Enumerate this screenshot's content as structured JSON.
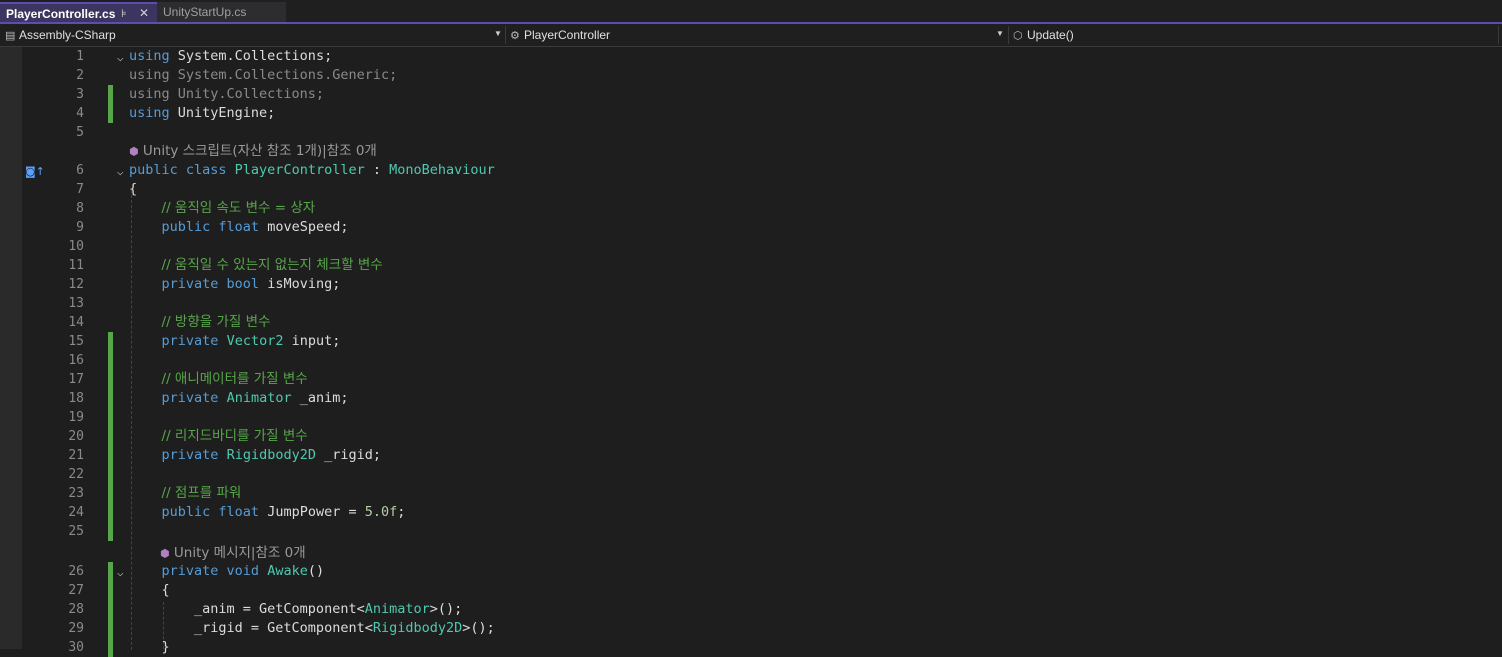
{
  "tabs": [
    {
      "label": "PlayerController.cs",
      "active": true
    },
    {
      "label": "UnityStartUp.cs",
      "active": false
    }
  ],
  "nav": {
    "project": "Assembly-CSharp",
    "class": "PlayerController",
    "member": "Update()"
  },
  "codelens": {
    "class_lens": "Unity 스크립트(자산 참조 1개)|참조 0개",
    "method_lens": "Unity 메시지|참조 0개"
  },
  "lines": [
    {
      "n": "1",
      "tokens": [
        [
          "kw",
          "using"
        ],
        [
          "tx",
          " System.Collections;"
        ]
      ]
    },
    {
      "n": "2",
      "tokens": [
        [
          "dim",
          "using System.Collections.Generic;"
        ]
      ]
    },
    {
      "n": "3",
      "tokens": [
        [
          "dim",
          "using Unity.Collections;"
        ]
      ]
    },
    {
      "n": "4",
      "tokens": [
        [
          "kw",
          "using"
        ],
        [
          "tx",
          " UnityEngine;"
        ]
      ]
    },
    {
      "n": "5",
      "tokens": []
    },
    {
      "n": "6",
      "tokens": [
        [
          "kw",
          "public class "
        ],
        [
          "ty",
          "PlayerController"
        ],
        [
          "tx",
          " : "
        ],
        [
          "ty",
          "MonoBehaviour"
        ]
      ]
    },
    {
      "n": "7",
      "tokens": [
        [
          "tx",
          "{"
        ]
      ]
    },
    {
      "n": "8",
      "tokens": [
        [
          "tx",
          "    "
        ],
        [
          "cm",
          "// 움직임 속도 변수 = 상자"
        ]
      ]
    },
    {
      "n": "9",
      "tokens": [
        [
          "tx",
          "    "
        ],
        [
          "kw",
          "public float"
        ],
        [
          "tx",
          " moveSpeed;"
        ]
      ]
    },
    {
      "n": "10",
      "tokens": []
    },
    {
      "n": "11",
      "tokens": [
        [
          "tx",
          "    "
        ],
        [
          "cm",
          "// 움직일 수 있는지 없는지 체크할 변수"
        ]
      ]
    },
    {
      "n": "12",
      "tokens": [
        [
          "tx",
          "    "
        ],
        [
          "kw",
          "private bool"
        ],
        [
          "tx",
          " isMoving;"
        ]
      ]
    },
    {
      "n": "13",
      "tokens": []
    },
    {
      "n": "14",
      "tokens": [
        [
          "tx",
          "    "
        ],
        [
          "cm",
          "// 방향을 가질 변수"
        ]
      ]
    },
    {
      "n": "15",
      "tokens": [
        [
          "tx",
          "    "
        ],
        [
          "kw",
          "private"
        ],
        [
          "tx",
          " "
        ],
        [
          "ty",
          "Vector2"
        ],
        [
          "tx",
          " input;"
        ]
      ]
    },
    {
      "n": "16",
      "tokens": []
    },
    {
      "n": "17",
      "tokens": [
        [
          "tx",
          "    "
        ],
        [
          "cm",
          "// 애니메이터를 가질 변수"
        ]
      ]
    },
    {
      "n": "18",
      "tokens": [
        [
          "tx",
          "    "
        ],
        [
          "kw",
          "private"
        ],
        [
          "tx",
          " "
        ],
        [
          "ty",
          "Animator"
        ],
        [
          "tx",
          " _anim;"
        ]
      ]
    },
    {
      "n": "19",
      "tokens": []
    },
    {
      "n": "20",
      "tokens": [
        [
          "tx",
          "    "
        ],
        [
          "cm",
          "// 리지드바디를 가질 변수"
        ]
      ]
    },
    {
      "n": "21",
      "tokens": [
        [
          "tx",
          "    "
        ],
        [
          "kw",
          "private"
        ],
        [
          "tx",
          " "
        ],
        [
          "ty",
          "Rigidbody2D"
        ],
        [
          "tx",
          " _rigid;"
        ]
      ]
    },
    {
      "n": "22",
      "tokens": []
    },
    {
      "n": "23",
      "tokens": [
        [
          "tx",
          "    "
        ],
        [
          "cm",
          "// 점프를 파워"
        ]
      ]
    },
    {
      "n": "24",
      "tokens": [
        [
          "tx",
          "    "
        ],
        [
          "kw",
          "public float"
        ],
        [
          "tx",
          " JumpPower = "
        ],
        [
          "nm",
          "5.0f"
        ],
        [
          "tx",
          ";"
        ]
      ]
    },
    {
      "n": "25",
      "tokens": []
    },
    {
      "n": "26",
      "tokens": [
        [
          "tx",
          "    "
        ],
        [
          "kw",
          "private void"
        ],
        [
          "tx",
          " "
        ],
        [
          "ty",
          "Awake"
        ],
        [
          "tx",
          "()"
        ]
      ]
    },
    {
      "n": "27",
      "tokens": [
        [
          "tx",
          "    {"
        ]
      ]
    },
    {
      "n": "28",
      "tokens": [
        [
          "tx",
          "        _anim = GetComponent<"
        ],
        [
          "ty",
          "Animator"
        ],
        [
          "tx",
          ">();"
        ]
      ]
    },
    {
      "n": "29",
      "tokens": [
        [
          "tx",
          "        _rigid = GetComponent<"
        ],
        [
          "ty",
          "Rigidbody2D"
        ],
        [
          "tx",
          ">();"
        ]
      ]
    },
    {
      "n": "30",
      "tokens": [
        [
          "tx",
          "    }"
        ]
      ]
    }
  ],
  "icons": {
    "pin": "pin-icon",
    "close": "close-icon",
    "dropdown": "chevron-down-icon",
    "fold": "fold-chevron-icon",
    "codelens": "unity-cube-icon",
    "bookmark": "go-to-base-icon"
  },
  "colors": {
    "keyword": "#569cd6",
    "type": "#4ec9b0",
    "comment": "#57a64a",
    "number": "#b5cea8",
    "change_bar": "#57a64a",
    "active_tab": "#3b3560"
  }
}
